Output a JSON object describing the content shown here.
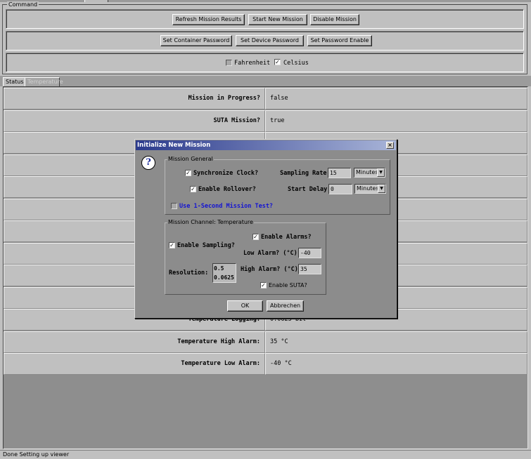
{
  "command": {
    "legend": "Command",
    "refresh_label": "Refresh Mission Results",
    "start_label": "Start New Mission",
    "disable_label": "Disable Mission",
    "set_container_pw_label": "Set Container Password",
    "set_device_pw_label": "Set Device Password",
    "set_pw_enable_label": "Set Password Enable",
    "fahrenheit_label": "Fahrenheit",
    "fahrenheit_checked": false,
    "celsius_label": "Celsius",
    "celsius_checked": true
  },
  "tabs": [
    {
      "label": "Status"
    },
    {
      "label": "Temperature"
    }
  ],
  "status_rows": [
    {
      "label": "Mission in Progress?",
      "value": "false"
    },
    {
      "label": "SUTA Mission?",
      "value": "true"
    },
    {
      "label": "",
      "value": ""
    },
    {
      "label": "",
      "value": ""
    },
    {
      "label": "",
      "value": ""
    },
    {
      "label": "",
      "value": ""
    },
    {
      "label": "",
      "value": ""
    },
    {
      "label": "",
      "value": ""
    },
    {
      "label": "",
      "value": ""
    },
    {
      "label": "",
      "value": ""
    },
    {
      "label": "Temperature Logging:",
      "value": "0.0625 bit"
    },
    {
      "label": "Temperature High Alarm:",
      "value": "35 °C"
    },
    {
      "label": "Temperature Low Alarm:",
      "value": "-40 °C"
    }
  ],
  "statusbar": {
    "text": "Done Setting up viewer"
  },
  "dialog": {
    "title": "Initialize New Mission",
    "close_glyph": "×",
    "icon_glyph": "?",
    "general": {
      "legend": "Mission General",
      "sync_clock_label": "Synchronize Clock?",
      "sync_clock_checked": true,
      "rollover_label": "Enable Rollover?",
      "rollover_checked": true,
      "one_second_label": "Use 1-Second Mission Test?",
      "one_second_checked": false,
      "sampling_rate_label": "Sampling Rate",
      "sampling_rate_value": "15",
      "sampling_rate_unit": "Minutes",
      "start_delay_label": "Start Delay",
      "start_delay_value": "0",
      "start_delay_unit": "Minutes"
    },
    "channel": {
      "legend": "Mission Channel: Temperature",
      "enable_alarms_label": "Enable Alarms?",
      "enable_alarms_checked": true,
      "enable_sampling_label": "Enable Sampling?",
      "enable_sampling_checked": true,
      "low_alarm_label": "Low Alarm? (°C)",
      "low_alarm_value": "-40",
      "high_alarm_label": "High Alarm? (°C)",
      "high_alarm_value": "35",
      "resolution_label": "Resolution:",
      "resolution_options": [
        "0.5",
        "0.0625"
      ],
      "enable_suta_label": "Enable SUTA?",
      "enable_suta_checked": true
    },
    "ok_label": "OK",
    "cancel_label": "Abbrechen"
  },
  "colors": {
    "background": "#c0c0c0",
    "dialog_bg": "#8c8c8c",
    "titlebar_start": "#2b3a8c",
    "titlebar_end": "#a8b4d8",
    "link_text": "#1414d2"
  }
}
